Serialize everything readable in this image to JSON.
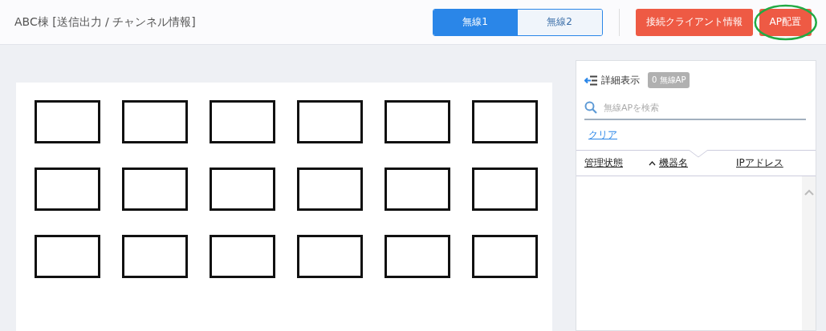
{
  "header": {
    "title": "ABC棟 [送信出力 / チャンネル情報]",
    "radio_tabs": [
      {
        "label": "無線1",
        "selected": true
      },
      {
        "label": "無線2",
        "selected": false
      }
    ],
    "buttons": [
      {
        "label": "接続クライアント情報",
        "highlighted": false
      },
      {
        "label": "AP配置",
        "highlighted": true
      }
    ]
  },
  "floor_plan": {
    "rooms": [
      {
        "kind": "room"
      },
      {
        "kind": "room"
      },
      {
        "kind": "room"
      },
      {
        "kind": "room"
      },
      {
        "kind": "room"
      },
      {
        "kind": "room"
      },
      {
        "kind": "room"
      },
      {
        "kind": "room"
      },
      {
        "kind": "room"
      },
      {
        "kind": "room"
      },
      {
        "kind": "room"
      },
      {
        "kind": "room"
      },
      {
        "kind": "room"
      },
      {
        "kind": "room"
      },
      {
        "kind": "room"
      },
      {
        "kind": "room"
      },
      {
        "kind": "room"
      },
      {
        "kind": "room"
      }
    ]
  },
  "side_panel": {
    "detail_toggle": "詳細表示",
    "count_badge": "0 無線AP",
    "search": {
      "placeholder": "無線APを検索"
    },
    "clear_link": "クリア",
    "columns": [
      {
        "label": "管理状態",
        "sorted": false
      },
      {
        "label": "機器名",
        "sorted": true
      },
      {
        "label": "IPアドレス",
        "sorted": false
      }
    ]
  }
}
